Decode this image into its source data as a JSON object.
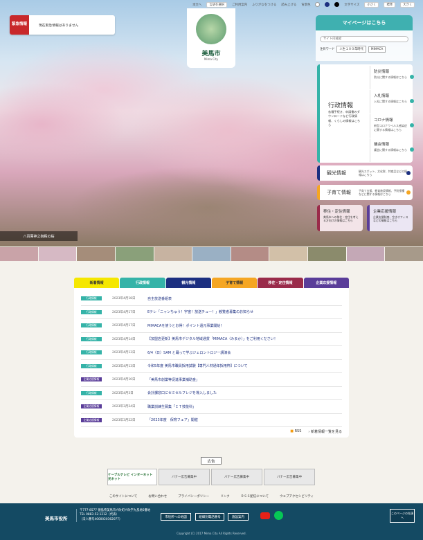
{
  "topbar": {
    "items": [
      "本文へ",
      "言語を選択",
      "ご利用案内",
      "ふりがなをつける",
      "読み上げる",
      "背景色",
      "文字サイズ",
      "小さく",
      "標準",
      "大きく"
    ]
  },
  "alert": {
    "label": "緊急情報",
    "message": "現在緊急情報はありません"
  },
  "logo": {
    "name": "美馬市",
    "sub": "Mima City"
  },
  "mypage": {
    "title": "マイページはこちら"
  },
  "search": {
    "placeholder": "サイト内検索",
    "hot_label": "注目ワード",
    "hot": [
      "人生１００年時代",
      "MIMACA"
    ]
  },
  "gyosei": {
    "title": "行政情報",
    "desc": "各種手続き、申請書のダウンロードなど行政情報、くらしの情報はこちら",
    "items": [
      {
        "title": "防災情報",
        "desc": "防災に関する情報はこちら"
      },
      {
        "title": "入札情報",
        "desc": "入札に関する情報はこちら"
      },
      {
        "title": "コロナ情報",
        "desc": "新型コロナウイルス感染症に関する情報はこちら"
      },
      {
        "title": "議会情報",
        "desc": "議会に関する情報はこちら"
      }
    ]
  },
  "kanko": {
    "title": "観光情報",
    "desc": "観光スポット、文化財、特産品などの情報はこちら"
  },
  "kosodate": {
    "title": "子育て情報",
    "desc": "子育て支援、教育施設情報、予防接種などに関する情報はこちら"
  },
  "iju": {
    "title": "移住・定住情報",
    "desc": "美馬市への移住・定住を考える方向けの情報はこちら"
  },
  "kigyo": {
    "title": "企業応援情報",
    "desc": "企業支援制度、空きオフィスなどの情報はこちら"
  },
  "caption": "八百萬神之御殿の桜",
  "news": {
    "tabs": [
      "新着情報",
      "行政情報",
      "観光情報",
      "子育て情報",
      "移住・定住情報",
      "企業応援情報"
    ],
    "rows": [
      {
        "cat": "行政情報",
        "date": "2023年4月18日",
        "title": "自主放送番組表"
      },
      {
        "cat": "行政情報",
        "date": "2023年4月17日",
        "title": "Eテレ「ニャンちゅう！宇宙！放送チュー！」観覧者募集のお知らせ"
      },
      {
        "cat": "行政情報",
        "date": "2023年4月17日",
        "title": "MIMACAを使うとお得！ポイント還元事業開始！"
      },
      {
        "cat": "行政情報",
        "date": "2023年4月14日",
        "title": "【加盟店更新】美馬市デジタル地域通貨「MIMACA（みまか）」をご利用ください！"
      },
      {
        "cat": "行政情報",
        "date": "2023年4月13日",
        "title": "6/4（日）SAM と踊って学ぶジェロントロジー講演会"
      },
      {
        "cat": "行政情報",
        "date": "2023年4月13日",
        "title": "令和5年度 美馬市職員採用試験【専門人材通年採用枠】について"
      },
      {
        "cat": "企業応援情報",
        "date": "2023年4月10日",
        "title": "「美馬市創業等促進事業補助金」"
      },
      {
        "cat": "行政情報",
        "date": "2023年4月3日",
        "title": "会計課窓口にセミセルフレジを導入しました"
      },
      {
        "cat": "企業応援情報",
        "date": "2023年3月24日",
        "title": "職業訓練生募集「ＩＴ技能科」"
      },
      {
        "cat": "企業応援情報",
        "date": "2023年3月22日",
        "title": "「2023年度　保育フェア」開催"
      }
    ],
    "rss": "RSS",
    "more": "新着情報一覧を見る"
  },
  "ad": {
    "label": "広告",
    "items": [
      "ケーブルテレビ インターネット 光ネット",
      "バナー広告募集中",
      "バナー広告募集中",
      "バナー広告募集中"
    ]
  },
  "links": [
    "このサイトについて",
    "お問い合わせ",
    "プライバシーポリシー",
    "リンク",
    "ＲＳＳ配信について",
    "ウェブアクセシビリティ"
  ],
  "footer": {
    "name": "美馬市役所",
    "zip": "〒777-8577 徳島県美馬市穴吹町穴吹字九反地5番地",
    "tel": "TEL 0883-52-1212（代表）",
    "corp": "（法人番号4000020362077）",
    "buttons": [
      "市役所への地図",
      "組織別電話番号",
      "施設案内"
    ],
    "top": "このページの先頭へ",
    "copyright": "Copyright (C) 2017 Mima City All Rights Reserved."
  },
  "colors": {
    "teal": "#35b3a8",
    "navy": "#144a63",
    "gyosei": "#35b3a8",
    "kanko": "#1c2f80",
    "kosodate": "#f5a623",
    "iju": "#9a2b4a",
    "kigyo": "#5a3d99",
    "new": "#f5e700"
  }
}
